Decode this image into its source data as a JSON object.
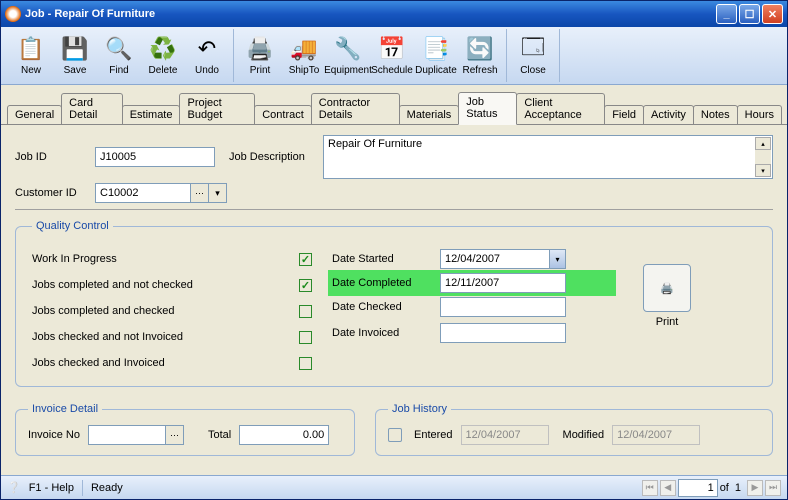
{
  "window": {
    "title": "Job - Repair Of Furniture"
  },
  "toolbar": [
    {
      "id": "new",
      "label": "New",
      "icon": "📋"
    },
    {
      "id": "save",
      "label": "Save",
      "icon": "💾"
    },
    {
      "id": "find",
      "label": "Find",
      "icon": "🔍"
    },
    {
      "id": "delete",
      "label": "Delete",
      "icon": "♻️"
    },
    {
      "id": "undo",
      "label": "Undo",
      "icon": "↶"
    },
    {
      "id": "print",
      "label": "Print",
      "icon": "🖨️"
    },
    {
      "id": "shipto",
      "label": "ShipTo",
      "icon": "🚚"
    },
    {
      "id": "equipment",
      "label": "Equipment",
      "icon": "🔧"
    },
    {
      "id": "schedule",
      "label": "Schedule",
      "icon": "📅"
    },
    {
      "id": "duplicate",
      "label": "Duplicate",
      "icon": "📑"
    },
    {
      "id": "refresh",
      "label": "Refresh",
      "icon": "🔄"
    },
    {
      "id": "close",
      "label": "Close",
      "icon": "🗔"
    }
  ],
  "tabs": [
    "General",
    "Card Detail",
    "Estimate",
    "Project Budget",
    "Contract",
    "Contractor Details",
    "Materials",
    "Job Status",
    "Client Acceptance",
    "Field",
    "Activity",
    "Notes",
    "Hours"
  ],
  "active_tab": "Job Status",
  "header": {
    "job_id_label": "Job ID",
    "job_id": "J10005",
    "customer_id_label": "Customer ID",
    "customer_id": "C10002",
    "job_desc_label": "Job Description",
    "job_desc": "Repair Of Furniture"
  },
  "qc": {
    "legend": "Quality Control",
    "checks": [
      {
        "label": "Work In Progress",
        "checked": true
      },
      {
        "label": "Jobs completed and not checked",
        "checked": true
      },
      {
        "label": "Jobs completed and checked",
        "checked": false
      },
      {
        "label": "Jobs checked and not Invoiced",
        "checked": false
      },
      {
        "label": "Jobs checked and Invoiced",
        "checked": false
      }
    ],
    "dates": {
      "started_label": "Date Started",
      "started": "12/04/2007",
      "completed_label": "Date Completed",
      "completed": "12/11/2007",
      "checked_label": "Date Checked",
      "checked": "",
      "invoiced_label": "Date Invoiced",
      "invoiced": ""
    },
    "print_label": "Print"
  },
  "invoice": {
    "legend": "Invoice Detail",
    "no_label": "Invoice No",
    "no": "",
    "total_label": "Total",
    "total": "0.00"
  },
  "history": {
    "legend": "Job History",
    "entered_label": "Entered",
    "entered": "12/04/2007",
    "modified_label": "Modified",
    "modified": "12/04/2007"
  },
  "status": {
    "help": "F1 - Help",
    "state": "Ready",
    "page": "1",
    "of_label": "of",
    "total_pages": "1"
  }
}
